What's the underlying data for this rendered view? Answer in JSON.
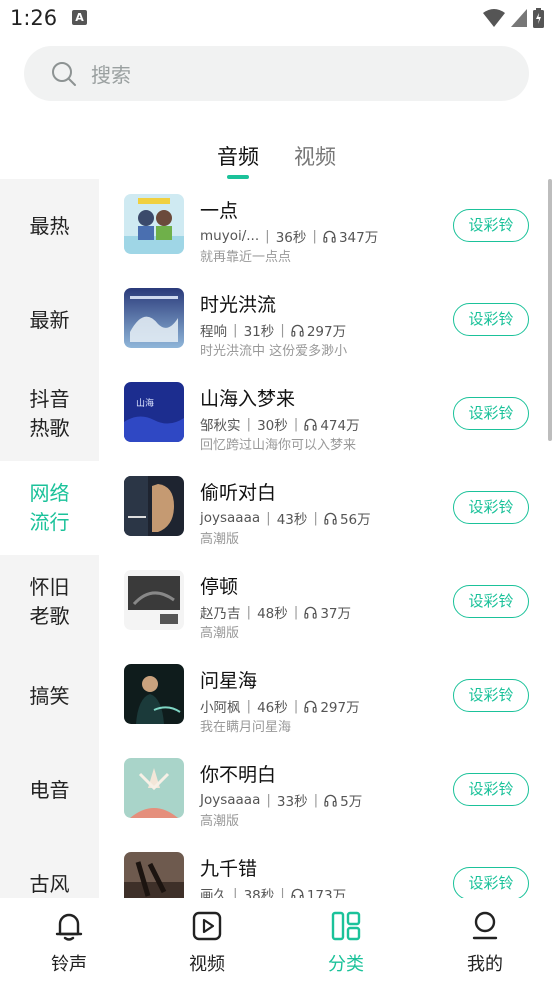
{
  "status_bar": {
    "time": "1:26",
    "notification_icon": "A"
  },
  "search": {
    "placeholder": "搜索"
  },
  "tabs": [
    {
      "label": "音频",
      "active": true
    },
    {
      "label": "视频",
      "active": false
    }
  ],
  "sidebar": {
    "items": [
      {
        "label": "最热",
        "active": false
      },
      {
        "label": "最新",
        "active": false
      },
      {
        "label": "抖音\n热歌",
        "active": false
      },
      {
        "label": "网络\n流行",
        "active": true
      },
      {
        "label": "怀旧\n老歌",
        "active": false
      },
      {
        "label": "搞笑",
        "active": false
      },
      {
        "label": "电音",
        "active": false
      },
      {
        "label": "古风",
        "active": false
      }
    ]
  },
  "songs": [
    {
      "title": "一点",
      "artist": "muyoi/...",
      "duration": "36秒",
      "plays": "347万",
      "desc": "就再靠近一点点",
      "button": "设彩铃"
    },
    {
      "title": "时光洪流",
      "artist": "程响",
      "duration": "31秒",
      "plays": "297万",
      "desc": "时光洪流中 这份爱多渺小",
      "button": "设彩铃"
    },
    {
      "title": "山海入梦来",
      "artist": "邹秋实",
      "duration": "30秒",
      "plays": "474万",
      "desc": "回忆跨过山海你可以入梦来",
      "button": "设彩铃"
    },
    {
      "title": "偷听对白",
      "artist": "joysaaaa",
      "duration": "43秒",
      "plays": "56万",
      "desc": "高潮版",
      "button": "设彩铃"
    },
    {
      "title": "停顿",
      "artist": "赵乃吉",
      "duration": "48秒",
      "plays": "37万",
      "desc": "高潮版",
      "button": "设彩铃"
    },
    {
      "title": "问星海",
      "artist": "小阿枫",
      "duration": "46秒",
      "plays": "297万",
      "desc": "我在瞒月问星海",
      "button": "设彩铃"
    },
    {
      "title": "你不明白",
      "artist": "Joysaaaa",
      "duration": "33秒",
      "plays": "5万",
      "desc": "高潮版",
      "button": "设彩铃"
    },
    {
      "title": "九千错",
      "artist": "画久",
      "duration": "38秒",
      "plays": "173万",
      "desc": "",
      "button": "设彩铃"
    }
  ],
  "bottom_nav": [
    {
      "label": "铃声",
      "icon": "bell-icon",
      "active": false
    },
    {
      "label": "视频",
      "icon": "video-icon",
      "active": false
    },
    {
      "label": "分类",
      "icon": "category-icon",
      "active": true
    },
    {
      "label": "我的",
      "icon": "profile-icon",
      "active": false
    }
  ],
  "colors": {
    "accent": "#1bc29a",
    "sidebar_bg": "#f4f4f4",
    "search_bg": "#f1f2f2"
  }
}
